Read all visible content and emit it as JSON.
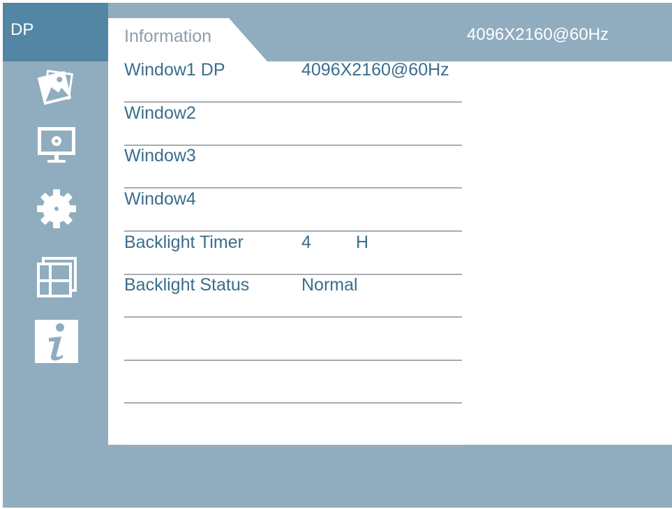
{
  "source": {
    "label": "DP"
  },
  "tab": {
    "label": "Information"
  },
  "header": {
    "resolution": "4096X2160@60Hz"
  },
  "sidebar": {
    "items": [
      {
        "icon": "picture-icon"
      },
      {
        "icon": "display-settings-icon"
      },
      {
        "icon": "gear-icon"
      },
      {
        "icon": "multi-window-icon"
      },
      {
        "icon": "info-icon"
      }
    ]
  },
  "info_rows": [
    {
      "label": "Window1 DP",
      "value": "4096X2160@60Hz",
      "unit": ""
    },
    {
      "label": "Window2",
      "value": "",
      "unit": ""
    },
    {
      "label": "Window3",
      "value": "",
      "unit": ""
    },
    {
      "label": "Window4",
      "value": "",
      "unit": ""
    },
    {
      "label": "Backlight Timer",
      "value": "4",
      "unit": "H"
    },
    {
      "label": "Backlight Status",
      "value": "Normal",
      "unit": ""
    },
    {
      "label": "",
      "value": "",
      "unit": ""
    },
    {
      "label": "",
      "value": "",
      "unit": ""
    },
    {
      "label": "",
      "value": "",
      "unit": ""
    }
  ],
  "colors": {
    "background": "#90adbf",
    "source_box": "#5286a4",
    "text": "#3a6d8c",
    "tab_text": "#8f9ea9",
    "divider": "#a6acb1"
  }
}
